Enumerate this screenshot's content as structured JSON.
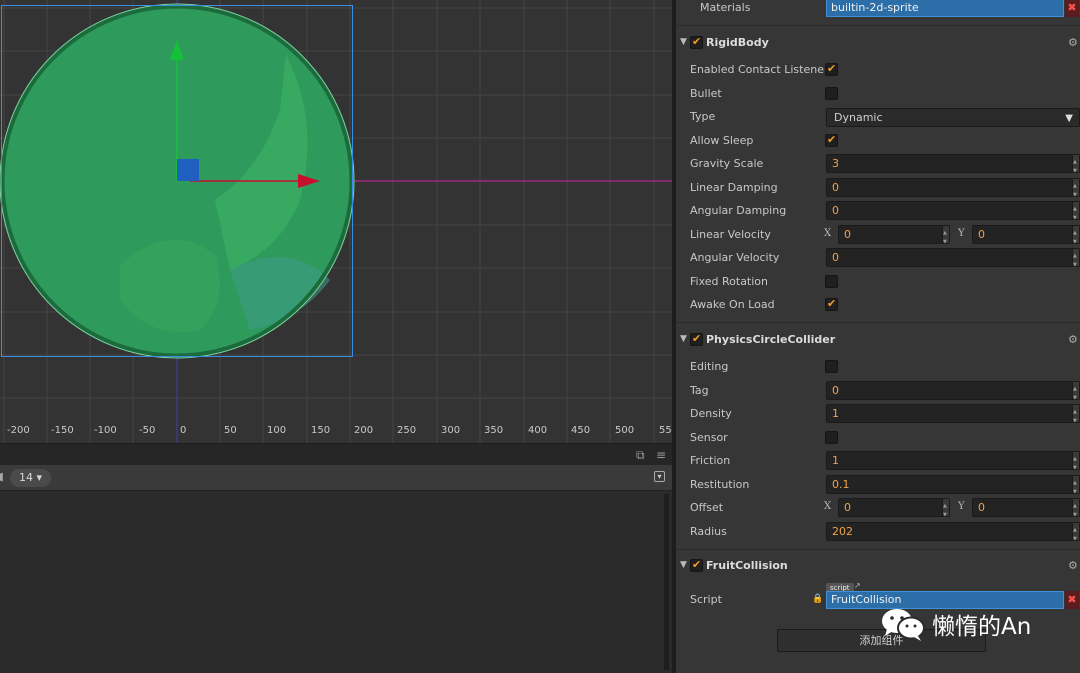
{
  "scene": {
    "ruler_labels": [
      "-200",
      "-150",
      "-100",
      "-50",
      "0",
      "50",
      "100",
      "150",
      "200",
      "250",
      "300",
      "350",
      "400",
      "450",
      "500",
      "55"
    ]
  },
  "console": {
    "font_size": "14 ▾"
  },
  "inspector": {
    "materials": {
      "label": "Materials",
      "value": "builtin-2d-sprite"
    },
    "rigidbody": {
      "title": "RigidBody",
      "enabled_contact_listener": {
        "label": "Enabled Contact Listener",
        "checked": true
      },
      "bullet": {
        "label": "Bullet",
        "checked": false
      },
      "type": {
        "label": "Type",
        "value": "Dynamic"
      },
      "allow_sleep": {
        "label": "Allow Sleep",
        "checked": true
      },
      "gravity_scale": {
        "label": "Gravity Scale",
        "value": "3"
      },
      "linear_damping": {
        "label": "Linear Damping",
        "value": "0"
      },
      "angular_damping": {
        "label": "Angular Damping",
        "value": "0"
      },
      "linear_velocity": {
        "label": "Linear Velocity",
        "x_label": "X",
        "x": "0",
        "y_label": "Y",
        "y": "0"
      },
      "angular_velocity": {
        "label": "Angular Velocity",
        "value": "0"
      },
      "fixed_rotation": {
        "label": "Fixed Rotation",
        "checked": false
      },
      "awake_on_load": {
        "label": "Awake On Load",
        "checked": true
      }
    },
    "collider": {
      "title": "PhysicsCircleCollider",
      "editing": {
        "label": "Editing",
        "checked": false
      },
      "tag": {
        "label": "Tag",
        "value": "0"
      },
      "density": {
        "label": "Density",
        "value": "1"
      },
      "sensor": {
        "label": "Sensor",
        "checked": false
      },
      "friction": {
        "label": "Friction",
        "value": "1"
      },
      "restitution": {
        "label": "Restitution",
        "value": "0.1"
      },
      "offset": {
        "label": "Offset",
        "x_label": "X",
        "x": "0",
        "y_label": "Y",
        "y": "0"
      },
      "radius": {
        "label": "Radius",
        "value": "202"
      }
    },
    "fruit_collision": {
      "title": "FruitCollision",
      "script_tag": "script",
      "script": {
        "label": "Script",
        "value": "FruitCollision"
      }
    },
    "add_component": "添加组件"
  },
  "watermark": {
    "text": "懒惰的An"
  },
  "colors": {
    "accent_orange": "#f39c2a",
    "asset_blue": "#2c6ea8",
    "circle_green": "#2e9a5c",
    "selection_blue": "#3a8ee6",
    "axis_x": "#c8102e",
    "axis_y": "#16c13a"
  }
}
